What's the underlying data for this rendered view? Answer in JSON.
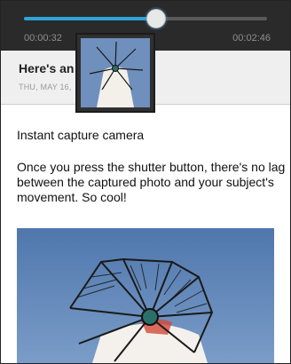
{
  "player": {
    "elapsed": "00:00:32",
    "total": "00:02:46",
    "progress": 0.54
  },
  "post": {
    "title": "Here's an",
    "date": "THU, MAY 16,",
    "heading": "Instant capture camera",
    "body": "Once you press the shutter button, there's no lag between the captured photo and your subject's movement. So cool!"
  },
  "colors": {
    "accent": "#2fa4d8",
    "player_bg": "#2a2a2a",
    "header_bg": "#efefef",
    "sky": "#5b82b8"
  },
  "icons": {
    "windmill_thumbnail": "windmill-thumbnail",
    "windmill_photo": "windmill-photo"
  }
}
